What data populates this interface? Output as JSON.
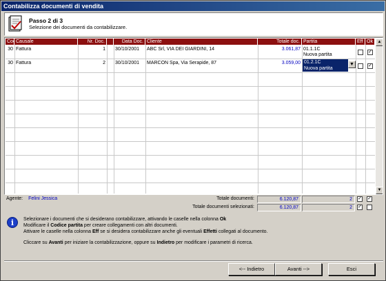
{
  "window": {
    "title": "Contabilizza documenti di vendita"
  },
  "header": {
    "step": "Passo 2 di 3",
    "subtitle": "Selezione dei documenti da contabilizzare."
  },
  "grid": {
    "columns": [
      "Cod",
      "Causale",
      "Nr. Doc.",
      "Data Doc.",
      "Cliente",
      "Totale doc.",
      "Partita",
      "Eff",
      "Ok"
    ],
    "rows": [
      {
        "cod": "30",
        "causale": "Fattura",
        "nr": "1",
        "data": "30/10/2001",
        "cliente": "ABC Srl, VIA DEI GIARDINI, 14",
        "totale": "3.061,87",
        "partita": "01.1.1C",
        "partita2": "Nuova partita",
        "eff": false,
        "ok": true
      },
      {
        "cod": "30",
        "causale": "Fattura",
        "nr": "2",
        "data": "30/10/2001",
        "cliente": "MARCON Spa, Via Serapide, 87",
        "totale": "3.059,00",
        "partita": "01.2.1C",
        "partita2": "Nuova partita",
        "eff": false,
        "ok": true
      }
    ]
  },
  "totals": {
    "agente_label": "Agente:",
    "agente_value": "Felini Jessica",
    "tot_doc_label": "Totale documenti:",
    "tot_doc_value": "6.120,87",
    "tot_doc_count": "2",
    "tot_sel_label": "Totale documenti selezionati:",
    "tot_sel_value": "6.120,87",
    "tot_sel_count": "2"
  },
  "info": {
    "l1a": "Selezionare i documenti che si desiderano contabilizzare, attivando le caselle nella colonna ",
    "l1b": "Ok",
    "l2a": "Modificare il ",
    "l2b": "Codice partita",
    "l2c": " per creare collegamenti con altri documenti.",
    "l3a": "Attivare le caselle nella colonna ",
    "l3b": "Eff",
    "l3c": " se si desidera contabilizzare anche gli eventuali ",
    "l3d": "Effetti",
    "l3e": " collegati al documento.",
    "l4a": "Cliccare su ",
    "l4b": "Avanti",
    "l4c": " per iniziare la contabilizzazione, oppure su ",
    "l4d": "Indietro",
    "l4e": " per modificare i parametri di ricerca."
  },
  "buttons": {
    "back": "<-- Indietro",
    "next": "Avanti -->",
    "exit": "Esci"
  },
  "colors": {
    "header_bg": "#8c1010",
    "selection": "#0a246a",
    "value_blue": "#0000c0"
  }
}
